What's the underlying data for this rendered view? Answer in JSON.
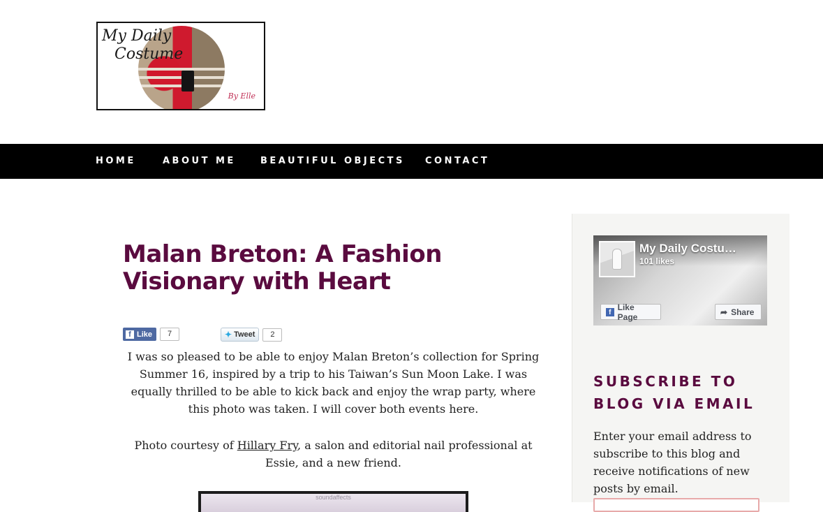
{
  "logo": {
    "line1": "My Daily",
    "line2": "Costume",
    "byline": "By Elle"
  },
  "nav": {
    "items": [
      {
        "label": "HOME"
      },
      {
        "label": "ABOUT ME"
      },
      {
        "label": "BEAUTIFUL OBJECTS"
      },
      {
        "label": "CONTACT"
      }
    ]
  },
  "post": {
    "title": "Malan Breton: A Fashion Visionary with Heart",
    "share": {
      "like_label": "Like",
      "like_count": "7",
      "tweet_label": "Tweet",
      "tweet_count": "2"
    },
    "paragraph1": "I was so pleased to be able to enjoy Malan Breton’s collection for Spring Summer 16, inspired by a trip to his Taiwan’s Sun Moon Lake. I was equally thrilled to be able to kick back and enjoy the wrap party, where this photo was taken. I will cover both events here.",
    "paragraph2_prefix": "Photo courtesy of ",
    "paragraph2_link": "Hillary Fry",
    "paragraph2_suffix": ", a salon and editorial nail professional at Essie, and a new friend.",
    "image_caption": "soundaffects"
  },
  "sidebar": {
    "facebook": {
      "page_name": "My Daily Costu…",
      "likes": "101 likes",
      "like_page_label": "Like Page",
      "share_label": "Share"
    },
    "subscribe": {
      "title": "SUBSCRIBE TO BLOG VIA EMAIL",
      "description": "Enter your email address to subscribe to this blog and receive notifications of new posts by email."
    }
  },
  "colors": {
    "accent": "#5a0b3f",
    "nav_background": "#000000",
    "facebook_blue": "#4e69a2"
  }
}
